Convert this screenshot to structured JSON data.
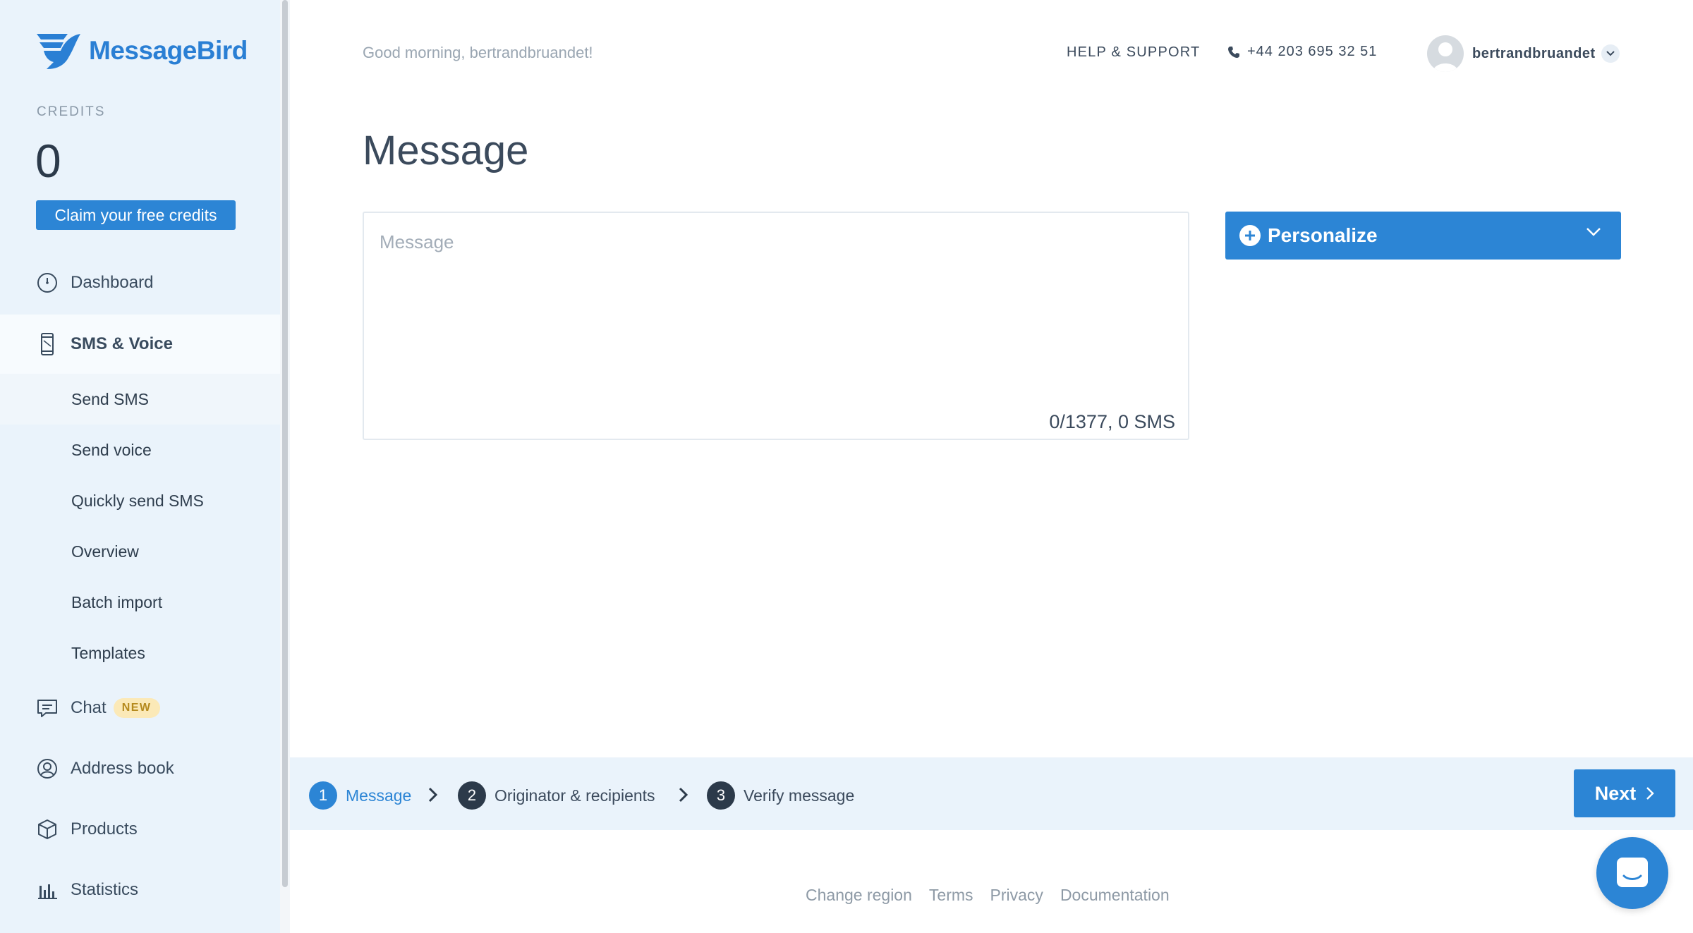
{
  "brand": {
    "name": "MessageBird",
    "accent": "#2c85d5"
  },
  "credits": {
    "label": "CREDITS",
    "value": "0",
    "claim_label": "Claim your free credits"
  },
  "sidebar": {
    "items": [
      {
        "label": "Dashboard",
        "icon": "dashboard-icon"
      },
      {
        "label": "SMS & Voice",
        "icon": "phone-device-icon",
        "active": true
      },
      {
        "label": "Chat",
        "icon": "chat-icon",
        "badge": "NEW"
      },
      {
        "label": "Address book",
        "icon": "address-book-icon"
      },
      {
        "label": "Products",
        "icon": "box-icon"
      },
      {
        "label": "Statistics",
        "icon": "bar-chart-icon"
      }
    ],
    "sub_items": [
      {
        "label": "Send SMS"
      },
      {
        "label": "Send voice"
      },
      {
        "label": "Quickly send SMS"
      },
      {
        "label": "Overview"
      },
      {
        "label": "Batch import"
      },
      {
        "label": "Templates"
      }
    ]
  },
  "header": {
    "greeting": "Good morning, bertrandbruandet!",
    "help": "HELP & SUPPORT",
    "phone": "+44 203 695 32 51",
    "username": "bertrandbruandet"
  },
  "main": {
    "title": "Message",
    "message_placeholder": "Message",
    "counter": "0/1377, 0 SMS",
    "personalize_label": "Personalize"
  },
  "steps": [
    {
      "num": "1",
      "label": "Message",
      "active": true
    },
    {
      "num": "2",
      "label": "Originator & recipients"
    },
    {
      "num": "3",
      "label": "Verify message"
    }
  ],
  "next_label": "Next",
  "footer": [
    "Change region",
    "Terms",
    "Privacy",
    "Documentation"
  ]
}
